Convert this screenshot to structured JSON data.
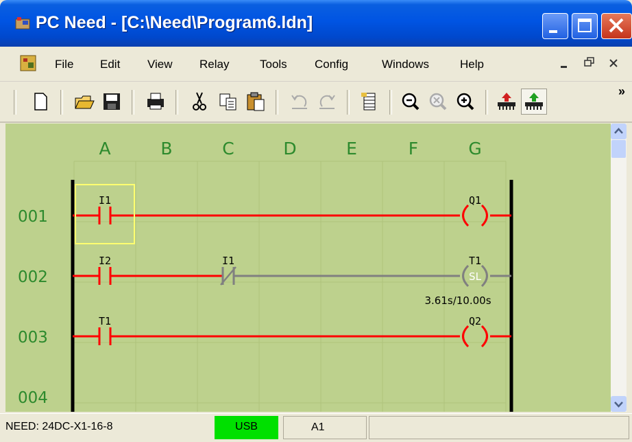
{
  "window": {
    "title": "PC Need - [C:\\Need\\Program6.ldn]"
  },
  "menu": {
    "items": [
      "File",
      "Edit",
      "View",
      "Relay",
      "Tools",
      "Config",
      "Windows",
      "Help"
    ]
  },
  "toolbar": {
    "overflow": "»",
    "icons": [
      "new-icon",
      "open-icon",
      "save-icon",
      "print-icon",
      "cut-icon",
      "copy-icon",
      "paste-icon",
      "undo-icon",
      "redo-icon",
      "monitor-icon",
      "zoom-out-icon",
      "zoom-reset-icon",
      "zoom-in-icon",
      "download-icon",
      "upload-icon"
    ]
  },
  "ladder": {
    "columns": [
      "A",
      "B",
      "C",
      "D",
      "E",
      "F",
      "G"
    ],
    "rungs": [
      "001",
      "002",
      "003",
      "004"
    ],
    "contacts": [
      {
        "label": "I1",
        "rung": 1,
        "col": "A",
        "type": "NO",
        "energized": true,
        "selected": true
      },
      {
        "label": "I2",
        "rung": 2,
        "col": "A",
        "type": "NO",
        "energized": true
      },
      {
        "label": "I1",
        "rung": 2,
        "col": "C",
        "type": "NC",
        "energized": false
      },
      {
        "label": "T1",
        "rung": 3,
        "col": "A",
        "type": "NO",
        "energized": true
      }
    ],
    "coils": [
      {
        "label": "Q1",
        "rung": 1,
        "type": "coil",
        "energized": true
      },
      {
        "label": "T1",
        "rung": 2,
        "type": "timer",
        "mode": "SL",
        "value": "3.61s/10.00s",
        "energized": false
      },
      {
        "label": "Q2",
        "rung": 3,
        "type": "coil",
        "energized": true
      }
    ]
  },
  "status": {
    "device": "NEED: 24DC-X1-16-8",
    "connection": "USB",
    "cell": "A1"
  },
  "colors": {
    "canvas": "#bdd18d",
    "grid": "#aec37c",
    "energized": "#ff0000",
    "off": "#808080",
    "label": "#2d8a2d",
    "usb": "#00e000"
  }
}
